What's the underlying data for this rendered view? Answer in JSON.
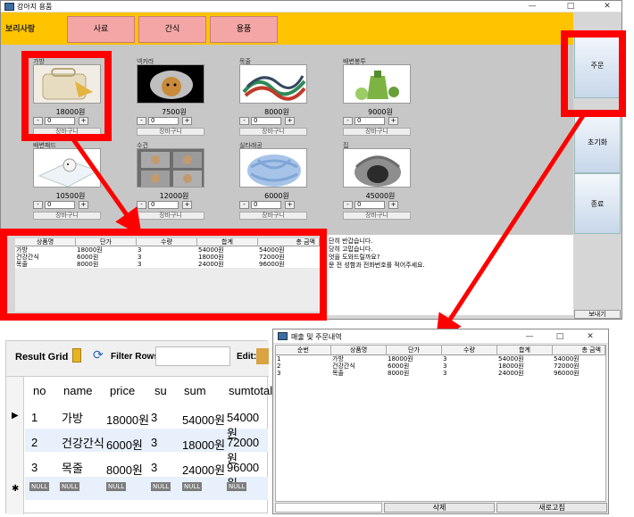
{
  "main_window": {
    "title": "강아지 용품",
    "controls": [
      "—",
      "□",
      "✕"
    ],
    "brand": "보리사랑",
    "tabs": [
      "사료",
      "간식",
      "용품"
    ],
    "products": [
      {
        "name": "가방",
        "price": "18000원",
        "qty": "0",
        "icon": "bag-icon"
      },
      {
        "name": "넥카라",
        "price": "7500원",
        "qty": "0",
        "icon": "dog-collar-icon"
      },
      {
        "name": "목줄",
        "price": "8000원",
        "qty": "0",
        "icon": "leash-icon"
      },
      {
        "name": "배변봉투",
        "price": "9000원",
        "qty": "0",
        "icon": "poop-bag-icon"
      },
      {
        "name": "배변패드",
        "price": "10500원",
        "qty": "0",
        "icon": "pad-icon"
      },
      {
        "name": "수건",
        "price": "12000원",
        "qty": "0",
        "icon": "towel-icon"
      },
      {
        "name": "실타래공",
        "price": "6000원",
        "qty": "0",
        "icon": "rope-ball-icon"
      },
      {
        "name": "집",
        "price": "45000원",
        "qty": "0",
        "icon": "dog-house-icon"
      }
    ],
    "minus": "-",
    "plus": "+",
    "cart_label": "장바구니",
    "side_buttons": [
      "주문",
      "초기화",
      "종료"
    ],
    "send_label": "보내기",
    "order_table": {
      "headers": [
        "상품명",
        "단가",
        "수량",
        "합계",
        "총 금액"
      ],
      "rows": [
        [
          "가방",
          "18000원",
          "3",
          "54000원",
          "54000원"
        ],
        [
          "건강간식",
          "6000원",
          "3",
          "18000원",
          "72000원"
        ],
        [
          "목줄",
          "8000원",
          "3",
          "24000원",
          "96000원"
        ]
      ]
    },
    "messages": [
      "단히 반갑습니다.",
      "당히 고맙습니다.",
      "엇을 도와드릴까요?",
      "문 전 성함과 전화번호를 적어주세요."
    ]
  },
  "result_grid": {
    "title": "Result Grid",
    "filter_label": "Filter Rows:",
    "edit_label": "Edit:",
    "headers": [
      "no",
      "name",
      "price",
      "su",
      "sum",
      "sumtotal"
    ],
    "rows": [
      [
        "1",
        "가방",
        "18000원",
        "3",
        "54000원",
        "54000원"
      ],
      [
        "2",
        "건강간식",
        "6000원",
        "3",
        "18000원",
        "72000원"
      ],
      [
        "3",
        "목줄",
        "8000원",
        "3",
        "24000원",
        "96000원"
      ]
    ],
    "null": "NULL"
  },
  "sales_window": {
    "title": "매출 및 주문내역",
    "controls": [
      "—",
      "□",
      "✕"
    ],
    "headers": [
      "순번",
      "상품명",
      "단가",
      "수량",
      "합계",
      "총 금액"
    ],
    "rows": [
      [
        "1",
        "가방",
        "18000원",
        "3",
        "54000원",
        "54000원"
      ],
      [
        "2",
        "건강간식",
        "6000원",
        "3",
        "18000원",
        "72000원"
      ],
      [
        "3",
        "목줄",
        "8000원",
        "3",
        "24000원",
        "96000원"
      ]
    ],
    "delete_label": "삭제",
    "refresh_label": "새로고침"
  },
  "colors": {
    "topbar": "#ffc300",
    "tab": "#f4a6a6",
    "highlight": "#ff0000",
    "sidebtn": "#c7d7ea"
  }
}
